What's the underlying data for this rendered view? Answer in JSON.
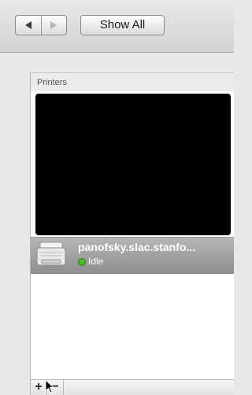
{
  "toolbar": {
    "back_icon": "left-arrow-icon",
    "forward_icon": "right-arrow-icon",
    "show_all_label": "Show All"
  },
  "printers_panel": {
    "title": "Printers",
    "list": [
      {
        "name": "panofsky.slac.stanfo...",
        "status": "Idle",
        "status_color": "#4cb82a",
        "icon": "printer-icon"
      }
    ]
  },
  "list_controls": {
    "add_label": "+",
    "remove_label": "−"
  }
}
